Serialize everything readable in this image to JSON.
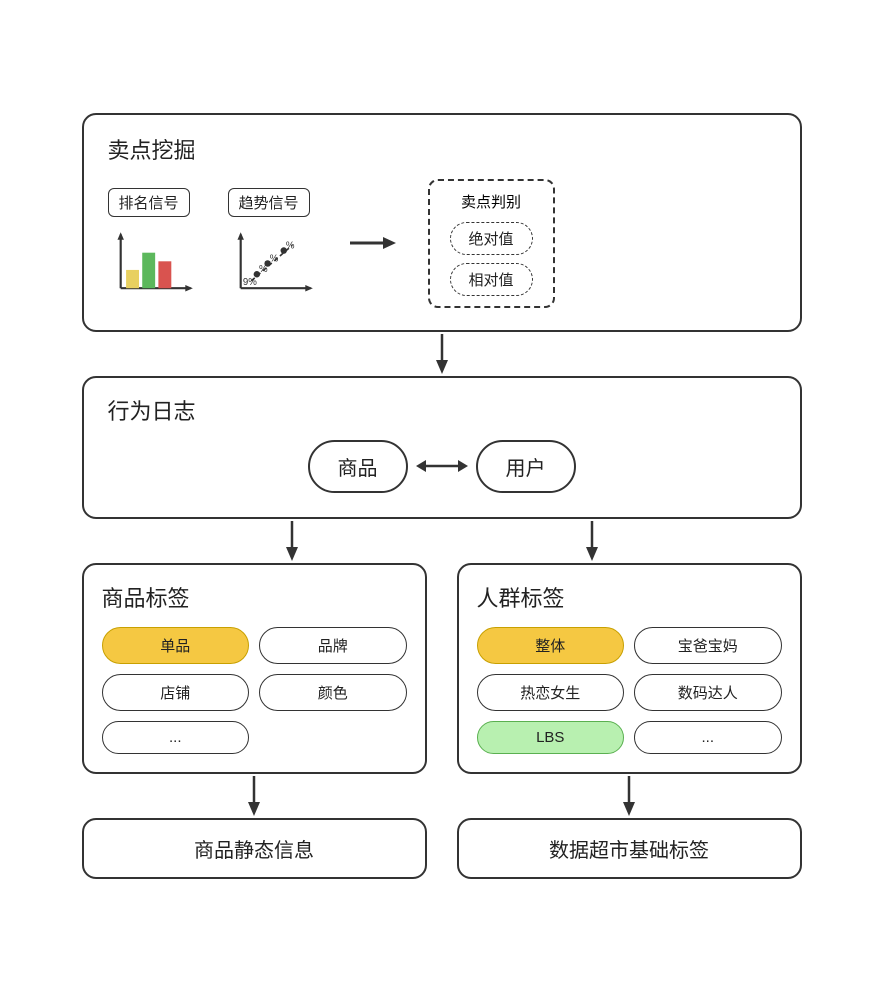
{
  "maidian": {
    "title": "卖点挖掘",
    "ranking_signal": "排名信号",
    "trend_signal": "趋势信号",
    "judge_title": "卖点判别",
    "judge_items": [
      "绝对值",
      "相对值"
    ]
  },
  "xingwei": {
    "title": "行为日志",
    "product": "商品",
    "user": "用户"
  },
  "product_tag": {
    "title": "商品标签",
    "tags": [
      "单品",
      "品牌",
      "店铺",
      "颜色",
      "..."
    ]
  },
  "crowd_tag": {
    "title": "人群标签",
    "tags": [
      "整体",
      "宝爸宝妈",
      "热恋女生",
      "数码达人",
      "LBS",
      "..."
    ]
  },
  "source_product": {
    "label": "商品静态信息"
  },
  "source_crowd": {
    "label": "数据超市基础标签"
  }
}
